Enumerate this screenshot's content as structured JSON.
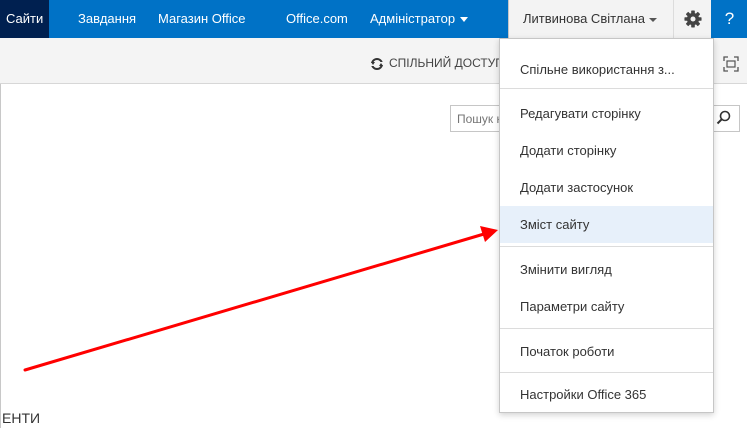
{
  "topnav": {
    "items": [
      "Сайти",
      "Завдання",
      "Магазин Office",
      "Office.com"
    ],
    "admin_label": "Адміністратор",
    "user_name": "Литвинова Світлана",
    "help_label": "?",
    "accent": "#0072c6",
    "active_bg": "#002050"
  },
  "toolbar": {
    "share_label": "СПІЛЬНИЙ ДОСТУП"
  },
  "search": {
    "placeholder": "Пошук на цьому сайті"
  },
  "settings_menu": {
    "groups": [
      [
        "Спільне використання з..."
      ],
      [
        "Редагувати сторінку",
        "Додати сторінку",
        "Додати застосунок",
        "Зміст сайту"
      ],
      [
        "Змінити вигляд",
        "Параметри сайту"
      ],
      [
        "Початок роботи"
      ],
      [
        "Настройки Office 365"
      ]
    ],
    "highlighted": "Зміст сайту"
  },
  "page": {
    "partial_text": "ЕНТИ"
  },
  "annotation": {
    "arrow_color": "#ff0000"
  }
}
